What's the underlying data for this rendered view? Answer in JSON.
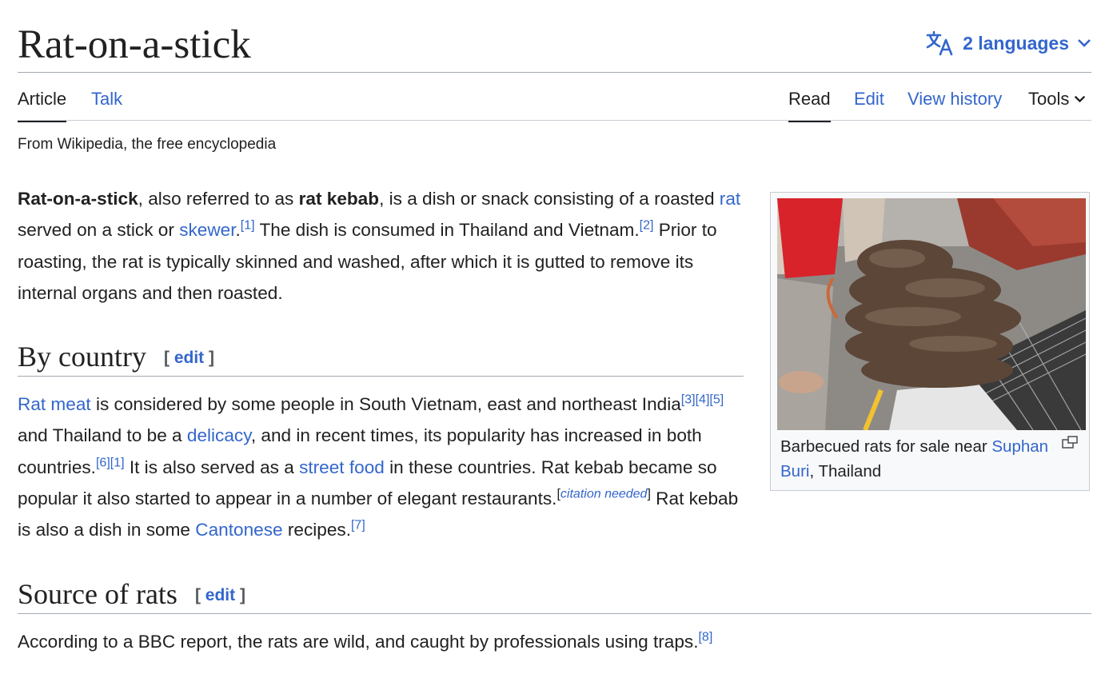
{
  "header": {
    "title": "Rat-on-a-stick",
    "languages_label": "2 languages"
  },
  "tabs": {
    "article": "Article",
    "talk": "Talk",
    "read": "Read",
    "edit": "Edit",
    "view_history": "View history",
    "tools": "Tools"
  },
  "tagline": "From Wikipedia, the free encyclopedia",
  "intro": {
    "bold1": "Rat-on-a-stick",
    "t1": ", also referred to as ",
    "bold2": "rat kebab",
    "t2": ", is a dish or snack consisting of a roasted ",
    "link_rat": "rat",
    "t3": " served on a stick or ",
    "link_skewer": "skewer",
    "t4": ".",
    "ref1": "[1]",
    "t5": " The dish is consumed in Thailand and Vietnam.",
    "ref2": "[2]",
    "t6": " Prior to roasting, the rat is typically skinned and washed, after which it is gutted to remove its internal organs and then roasted."
  },
  "section_country": {
    "heading": "By country",
    "edit_open": "[ ",
    "edit_label": "edit",
    "edit_close": " ]",
    "link_rat_meat": "Rat meat",
    "t1": " is considered by some people in South Vietnam, east and northeast India",
    "ref3": "[3]",
    "ref4": "[4]",
    "ref5": "[5]",
    "t2": " and Thailand to be a ",
    "link_delicacy": "delicacy",
    "t3": ", and in recent times, its popularity has increased in both countries.",
    "ref6": "[6]",
    "ref1b": "[1]",
    "t4": " It is also served as a ",
    "link_street_food": "street food",
    "t5": " in these countries. Rat kebab became so popular it also started to appear in a number of elegant restaurants.",
    "cite_open": "[",
    "cite_needed": "citation needed",
    "cite_close": "]",
    "t6": " Rat kebab is also a dish in some ",
    "link_cantonese": "Cantonese",
    "t7": " recipes.",
    "ref7": "[7]"
  },
  "section_source": {
    "heading": "Source of rats",
    "edit_open": "[ ",
    "edit_label": "edit",
    "edit_close": " ]",
    "t1": "According to a BBC report, the rats are wild, and caught by professionals using traps.",
    "ref8": "[8]"
  },
  "figure": {
    "caption_t1": "Barbecued rats for sale near ",
    "caption_link": "Suphan Buri",
    "caption_t2": ", Thailand"
  },
  "colors": {
    "link": "#3366cc",
    "text": "#202122",
    "border": "#a2a9b1"
  }
}
